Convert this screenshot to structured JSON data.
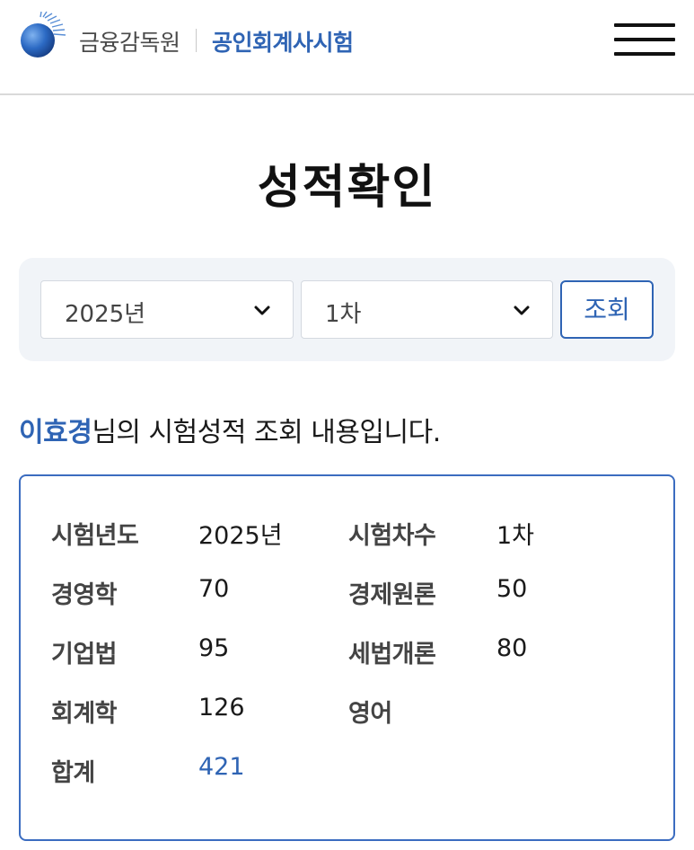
{
  "header": {
    "brand": "금융감독원",
    "service": "공인회계사시험"
  },
  "page_title": "성적확인",
  "search": {
    "year_value": "2025년",
    "round_value": "1차",
    "button_label": "조회"
  },
  "message": {
    "name": "이효경",
    "suffix": "님의 시험성적 조회 내용입니다."
  },
  "result": {
    "exam_year_label": "시험년도",
    "exam_year_value": "2025년",
    "exam_round_label": "시험차수",
    "exam_round_value": "1차",
    "subjects": [
      {
        "label": "경영학",
        "value": "70"
      },
      {
        "label": "경제원론",
        "value": "50"
      },
      {
        "label": "기업법",
        "value": "95"
      },
      {
        "label": "세법개론",
        "value": "80"
      },
      {
        "label": "회계학",
        "value": "126"
      },
      {
        "label": "영어",
        "value": ""
      }
    ],
    "total_label": "합계",
    "total_value": "421"
  },
  "colors": {
    "accent": "#2f64b4",
    "panel_bg": "#f1f4f8",
    "box_border": "#3b6cc0"
  }
}
